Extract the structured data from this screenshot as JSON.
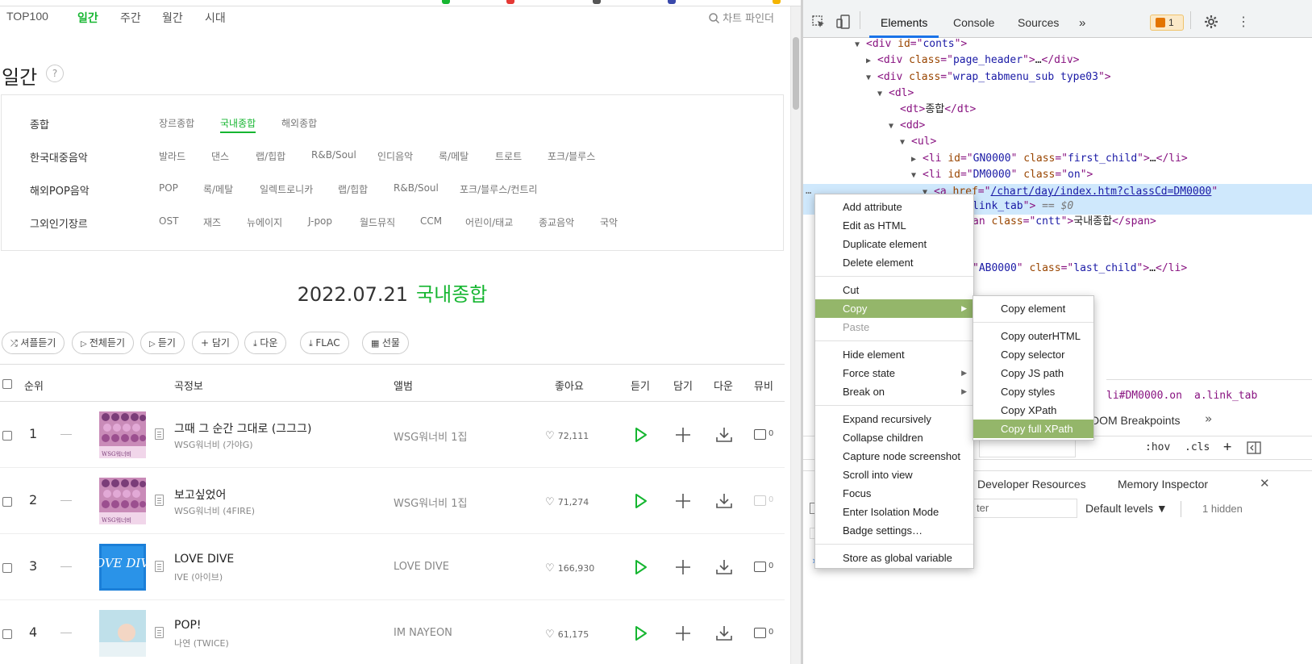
{
  "site": {
    "subnav": [
      "TOP100",
      "일간",
      "주간",
      "월간",
      "시대"
    ],
    "finder": "차트 파인더",
    "page_title": "일간",
    "help": "?",
    "filters": [
      {
        "category": "종합",
        "options": [
          "장르종합",
          "국내종합",
          "해외종합"
        ],
        "selected": "국내종합"
      },
      {
        "category": "한국대중음악",
        "options": [
          "발라드",
          "댄스",
          "랩/힙합",
          "R&B/Soul",
          "인디음악",
          "록/메탈",
          "트로트",
          "포크/블루스"
        ]
      },
      {
        "category": "해외POP음악",
        "options": [
          "POP",
          "록/메탈",
          "일렉트로니카",
          "랩/힙합",
          "R&B/Soul",
          "포크/블루스/컨트리"
        ]
      },
      {
        "category": "그외인기장르",
        "options": [
          "OST",
          "재즈",
          "뉴에이지",
          "J-pop",
          "월드뮤직",
          "CCM",
          "어린이/태교",
          "종교음악",
          "국악"
        ]
      }
    ],
    "date": "2022.07.21",
    "chart_name": "국내종합",
    "buttons": [
      "셔플듣기",
      "전체듣기",
      "듣기",
      "담기",
      "다운",
      "FLAC",
      "선물"
    ],
    "columns": {
      "rank": "순위",
      "song": "곡정보",
      "album": "앨범",
      "likes": "좋아요",
      "listen": "듣기",
      "add": "담기",
      "down": "다운",
      "mv": "뮤비"
    },
    "rows": [
      {
        "rank": "1",
        "title": "그때 그 순간 그대로 (그그그)",
        "artist": "WSG워너비 (가야G)",
        "album": "WSG워너비 1집",
        "likes": "72,111",
        "mv": "0",
        "mv_enabled": true
      },
      {
        "rank": "2",
        "title": "보고싶었어",
        "artist": "WSG워너비 (4FIRE)",
        "album": "WSG워너비 1집",
        "likes": "71,274",
        "mv": "0",
        "mv_enabled": false
      },
      {
        "rank": "3",
        "title": "LOVE DIVE",
        "artist": "IVE (아이브)",
        "album": "LOVE DIVE",
        "likes": "166,930",
        "mv": "0",
        "mv_enabled": true
      },
      {
        "rank": "4",
        "title": "POP!",
        "artist": "나연 (TWICE)",
        "album": "IM NAYEON",
        "likes": "61,175",
        "mv": "0",
        "mv_enabled": true
      }
    ],
    "cover_art": [
      "WSG워너비",
      "WSG워너비",
      "LOVE DIVE",
      ""
    ],
    "colors": {
      "accent": "#16b631"
    }
  },
  "devtools": {
    "tabs": [
      "Elements",
      "Console",
      "Sources"
    ],
    "issues_count": "1",
    "dom": [
      {
        "indent": 78,
        "tri": "▼",
        "html": "<div id=\"conts\">",
        "parts": [
          [
            "tag",
            "<div "
          ],
          [
            "attr",
            "id"
          ],
          [
            "tag",
            "=\""
          ],
          [
            "val",
            "conts"
          ],
          [
            "tag",
            "\">"
          ]
        ]
      },
      {
        "indent": 92,
        "tri": "▶",
        "parts": [
          [
            "tag",
            "<div "
          ],
          [
            "attr",
            "class"
          ],
          [
            "tag",
            "=\""
          ],
          [
            "val",
            "page_header"
          ],
          [
            "tag",
            "\">"
          ],
          [
            "txt",
            "…"
          ],
          [
            "tag",
            "</div>"
          ]
        ]
      },
      {
        "indent": 92,
        "tri": "▼",
        "parts": [
          [
            "tag",
            "<div "
          ],
          [
            "attr",
            "class"
          ],
          [
            "tag",
            "=\""
          ],
          [
            "val",
            "wrap_tabmenu_sub type03"
          ],
          [
            "tag",
            "\">"
          ]
        ]
      },
      {
        "indent": 106,
        "tri": "▼",
        "parts": [
          [
            "tag",
            "<dl>"
          ]
        ]
      },
      {
        "indent": 120,
        "tri": "",
        "parts": [
          [
            "tag",
            "<dt>"
          ],
          [
            "txt",
            "종합"
          ],
          [
            "tag",
            "</dt>"
          ]
        ]
      },
      {
        "indent": 120,
        "tri": "▼",
        "parts": [
          [
            "tag",
            "<dd>"
          ]
        ]
      },
      {
        "indent": 134,
        "tri": "▼",
        "parts": [
          [
            "tag",
            "<ul>"
          ]
        ]
      },
      {
        "indent": 148,
        "tri": "▶",
        "parts": [
          [
            "tag",
            "<li "
          ],
          [
            "attr",
            "id"
          ],
          [
            "tag",
            "=\""
          ],
          [
            "val",
            "GN0000"
          ],
          [
            "tag",
            "\" "
          ],
          [
            "attr",
            "class"
          ],
          [
            "tag",
            "=\""
          ],
          [
            "val",
            "first_child"
          ],
          [
            "tag",
            "\">"
          ],
          [
            "txt",
            "…"
          ],
          [
            "tag",
            "</li>"
          ]
        ]
      },
      {
        "indent": 148,
        "tri": "▼",
        "parts": [
          [
            "tag",
            "<li "
          ],
          [
            "attr",
            "id"
          ],
          [
            "tag",
            "=\""
          ],
          [
            "val",
            "DM0000"
          ],
          [
            "tag",
            "\" "
          ],
          [
            "attr",
            "class"
          ],
          [
            "tag",
            "=\""
          ],
          [
            "val",
            "on"
          ],
          [
            "tag",
            "\">"
          ]
        ]
      },
      {
        "indent": 162,
        "tri": "▼",
        "parts": [
          [
            "tag",
            "<a "
          ],
          [
            "attr",
            "href"
          ],
          [
            "tag",
            "=\""
          ],
          [
            "val",
            "/chart/day/index.htm?classCd=DM0000"
          ],
          [
            "tag",
            "\""
          ]
        ]
      },
      {
        "indent": 210,
        "tri": "",
        "parts": [
          [
            "val",
            "link_tab"
          ],
          [
            "tag",
            "\">"
          ],
          [
            "txt",
            " == $0"
          ]
        ]
      },
      {
        "indent": 210,
        "tri": "",
        "parts": [
          [
            "tag",
            "an "
          ],
          [
            "attr",
            "class"
          ],
          [
            "tag",
            "=\""
          ],
          [
            "val",
            "cntt"
          ],
          [
            "tag",
            "\">"
          ],
          [
            "txt",
            "국내종합"
          ],
          [
            "tag",
            "</span>"
          ]
        ]
      },
      {
        "indent": 210,
        "tri": "",
        "parts": [
          [
            "tag",
            "\""
          ],
          [
            "val",
            "AB0000"
          ],
          [
            "tag",
            "\" "
          ],
          [
            "attr",
            "class"
          ],
          [
            "tag",
            "=\""
          ],
          [
            "val",
            "last_child"
          ],
          [
            "tag",
            "\">"
          ],
          [
            "txt",
            "…"
          ],
          [
            "tag",
            "</li>"
          ]
        ]
      }
    ],
    "breadcrumbs": [
      "li#DM0000.on",
      "a.link_tab"
    ],
    "subtabs": [
      "DOM Breakpoints"
    ],
    "filter_tools": [
      ":hov",
      ".cls",
      "+"
    ],
    "drawer_tabs": [
      "Developer Resources",
      "Memory Inspector"
    ],
    "console": {
      "filter_placeholder": "ter",
      "levels": "Default levels ▼",
      "hidden": "1 hidden"
    },
    "context_menu": [
      {
        "label": "Add attribute"
      },
      {
        "label": "Edit as HTML"
      },
      {
        "label": "Duplicate element"
      },
      {
        "label": "Delete element"
      },
      {
        "sep": true
      },
      {
        "label": "Cut"
      },
      {
        "label": "Copy",
        "submenu": true,
        "highlight": true
      },
      {
        "label": "Paste",
        "disabled": true
      },
      {
        "sep": true
      },
      {
        "label": "Hide element"
      },
      {
        "label": "Force state",
        "submenu": true
      },
      {
        "label": "Break on",
        "submenu": true
      },
      {
        "sep": true
      },
      {
        "label": "Expand recursively"
      },
      {
        "label": "Collapse children"
      },
      {
        "label": "Capture node screenshot"
      },
      {
        "label": "Scroll into view"
      },
      {
        "label": "Focus"
      },
      {
        "label": "Enter Isolation Mode"
      },
      {
        "label": "Badge settings…"
      },
      {
        "sep": true
      },
      {
        "label": "Store as global variable"
      }
    ],
    "copy_submenu": [
      {
        "label": "Copy element"
      },
      {
        "sep": true
      },
      {
        "label": "Copy outerHTML"
      },
      {
        "label": "Copy selector"
      },
      {
        "label": "Copy JS path"
      },
      {
        "label": "Copy styles"
      },
      {
        "label": "Copy XPath"
      },
      {
        "label": "Copy full XPath",
        "highlight": true
      }
    ],
    "colors": {
      "menu_highlight": "#94b66a",
      "selection": "#cfe8fc"
    }
  }
}
